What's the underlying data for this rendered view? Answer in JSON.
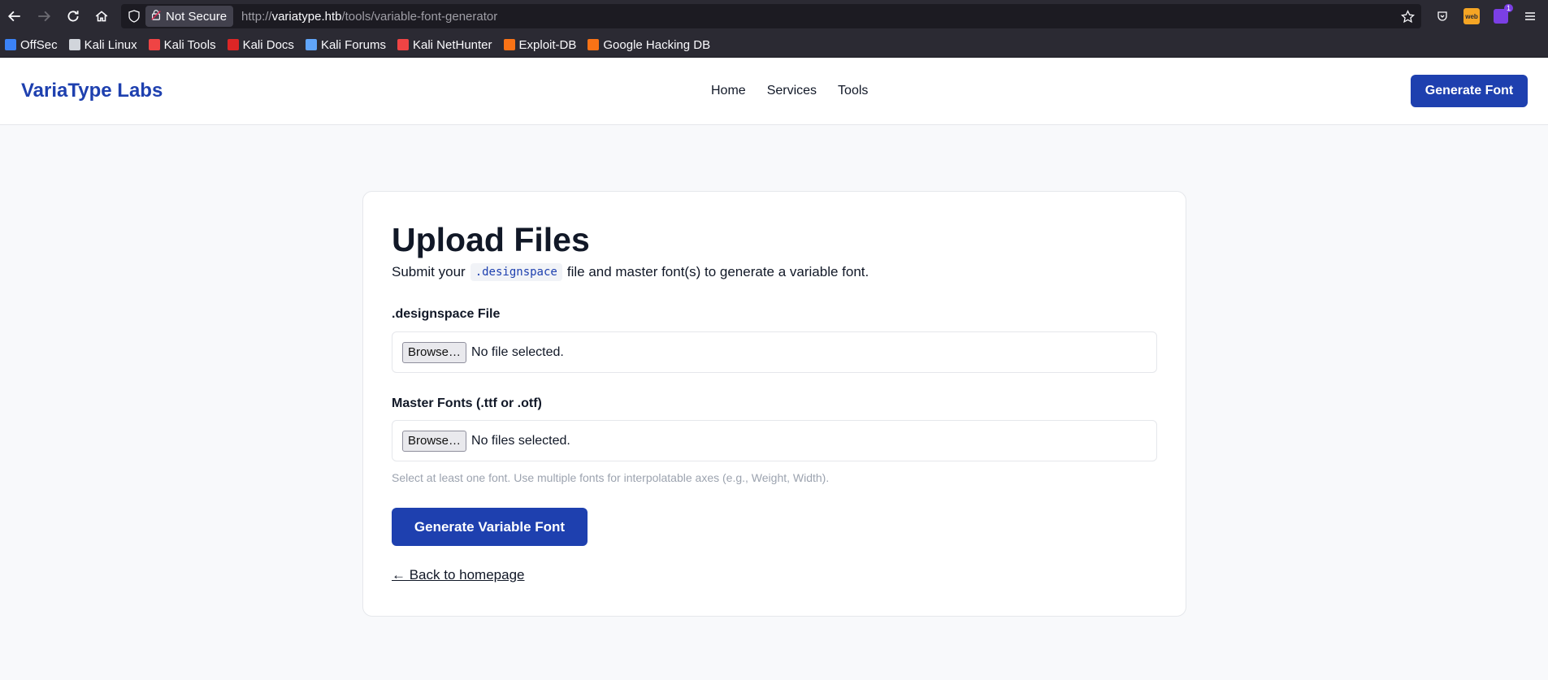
{
  "browser": {
    "security_label": "Not Secure",
    "url_prefix": "http://",
    "url_host": "variatype.htb",
    "url_path": "/tools/variable-font-generator",
    "extension_web_label": "web",
    "extension_badge": "1",
    "bookmarks": [
      {
        "label": "OffSec",
        "icon": "offsec-icon",
        "color": "#3b82f6"
      },
      {
        "label": "Kali Linux",
        "icon": "kali-dragon-icon",
        "color": "#d1d5db"
      },
      {
        "label": "Kali Tools",
        "icon": "kali-tools-icon",
        "color": "#ef4444"
      },
      {
        "label": "Kali Docs",
        "icon": "kali-docs-icon",
        "color": "#dc2626"
      },
      {
        "label": "Kali Forums",
        "icon": "kali-forums-icon",
        "color": "#60a5fa"
      },
      {
        "label": "Kali NetHunter",
        "icon": "kali-nethunter-icon",
        "color": "#ef4444"
      },
      {
        "label": "Exploit-DB",
        "icon": "exploit-db-icon",
        "color": "#f97316"
      },
      {
        "label": "Google Hacking DB",
        "icon": "ghdb-icon",
        "color": "#f97316"
      }
    ]
  },
  "header": {
    "brand": "VariaType Labs",
    "nav": [
      "Home",
      "Services",
      "Tools"
    ],
    "cta": "Generate Font"
  },
  "upload": {
    "title": "Upload Files",
    "subtitle_before": "Submit your",
    "subtitle_code": ".designspace",
    "subtitle_after": "file and master font(s) to generate a variable font.",
    "designspace_label": ".designspace File",
    "designspace_browse": "Browse…",
    "designspace_status": "No file selected.",
    "fonts_label": "Master Fonts (.ttf or .otf)",
    "fonts_browse": "Browse…",
    "fonts_status": "No files selected.",
    "hint": "Select at least one font. Use multiple fonts for interpolatable axes (e.g., Weight, Width).",
    "submit": "Generate Variable Font",
    "back": "← Back to homepage"
  },
  "colors": {
    "brand": "#1e40af",
    "chrome": "#2b2a33",
    "page_bg": "#f8f9fb"
  }
}
